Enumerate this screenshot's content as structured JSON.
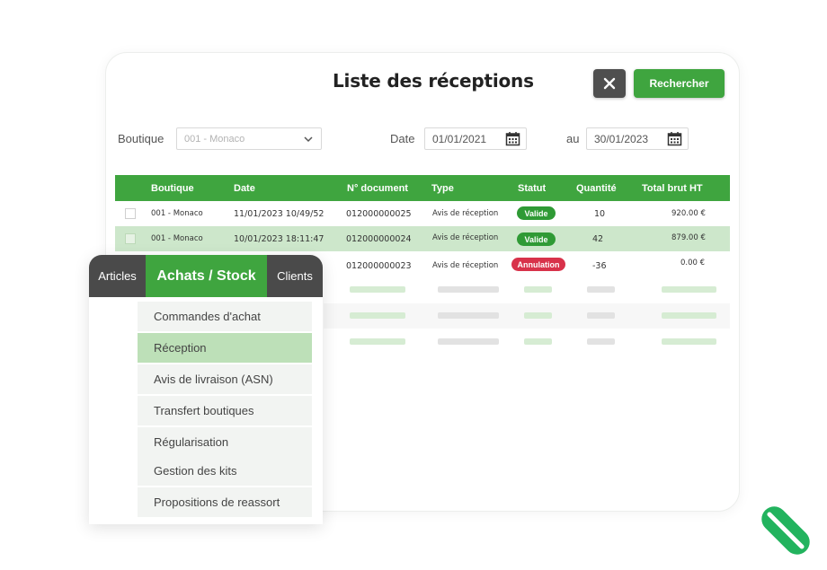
{
  "header": {
    "title": "Liste des réceptions",
    "search_label": "Rechercher"
  },
  "filters": {
    "boutique_label": "Boutique",
    "boutique_value": "001 - Monaco",
    "date_label": "Date",
    "date_from": "01/01/2021",
    "au_label": "au",
    "date_to": "30/01/2023"
  },
  "table": {
    "columns": [
      "Boutique",
      "Date",
      "N° document",
      "Type",
      "Statut",
      "Quantité",
      "Total brut HT"
    ],
    "rows": [
      {
        "boutique": "001 - Monaco",
        "date": "11/01/2023 10/49/52",
        "document": "012000000025",
        "type": "Avis de réception",
        "statut": "Valide",
        "quantite": "10",
        "total": "920.00 €"
      },
      {
        "boutique": "001 - Monaco",
        "date": "10/01/2023 18:11:47",
        "document": "012000000024",
        "type": "Avis de réception",
        "statut": "Valide",
        "quantite": "42",
        "total": "879.00 €"
      },
      {
        "boutique": "",
        "date": "",
        "document": "012000000023",
        "type": "Avis de réception",
        "statut": "Annulation",
        "quantite": "-36",
        "total": "0.00 €"
      }
    ]
  },
  "menu": {
    "tabs": [
      "Articles",
      "Achats / Stock",
      "Clients"
    ],
    "active_tab": "Achats / Stock",
    "items": [
      "Commandes d'achat",
      "Réception",
      "Avis de livraison (ASN)",
      "Transfert boutiques",
      "Régularisation",
      "Gestion des kits",
      "Propositions de reassort"
    ],
    "active_item": "Réception"
  },
  "colors": {
    "brand_green": "#3fa53f",
    "dark": "#4a4a4a",
    "cancel_red": "#d8324a",
    "selected_row": "#cde7cb"
  },
  "icons": [
    "close-icon",
    "chevron-down-icon",
    "calendar-icon",
    "brand-logo"
  ]
}
